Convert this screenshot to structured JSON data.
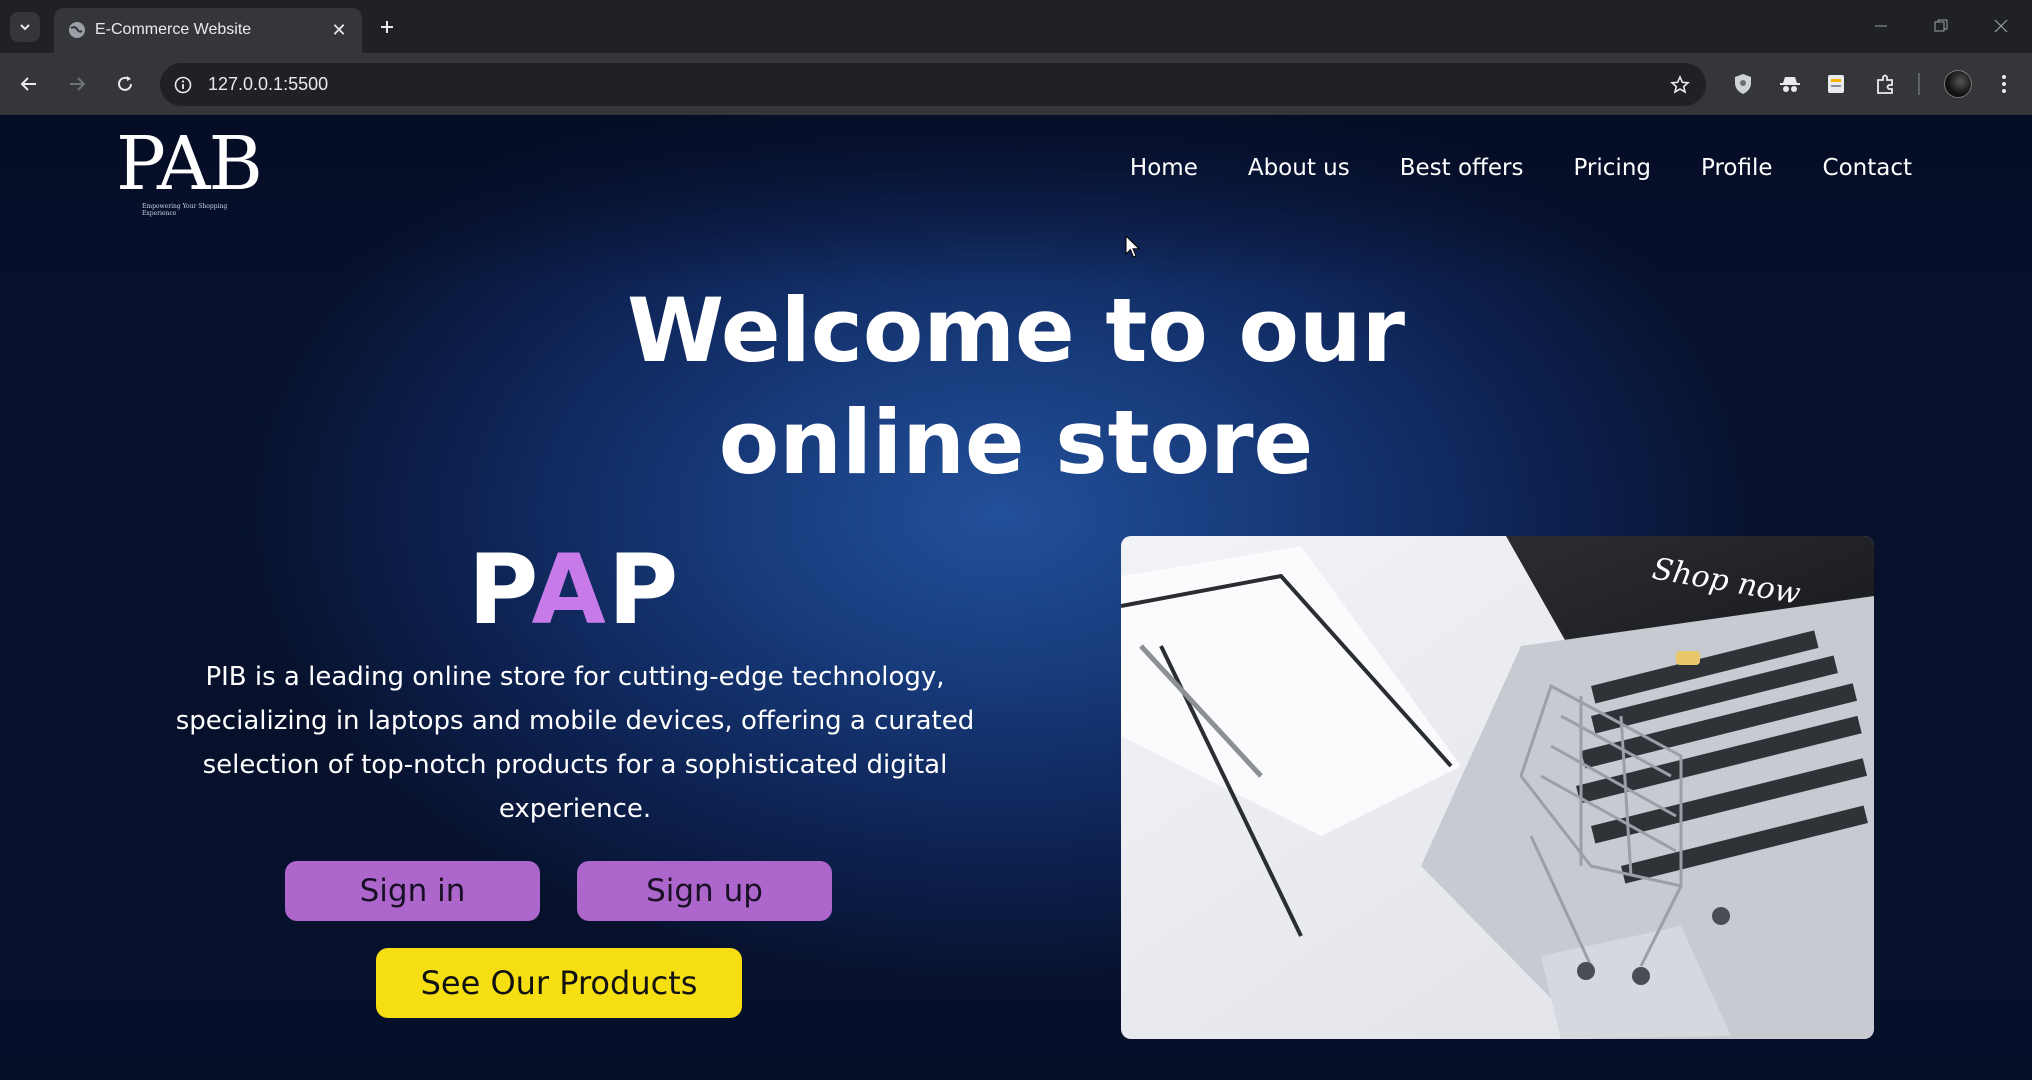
{
  "browser": {
    "tab_title": "E-Commerce Website",
    "url": "127.0.0.1:5500"
  },
  "site": {
    "logo_text": "PAB",
    "logo_tagline": "Empowering Your Shopping Experience",
    "nav": [
      "Home",
      "About us",
      "Best offers",
      "Pricing",
      "Profile",
      "Contact"
    ],
    "hero_title_line1": "Welcome to our",
    "hero_title_line2": "online store",
    "brand_part1": "P",
    "brand_part2": "A",
    "brand_part3": "P",
    "description": "PIB is a leading online store for cutting-edge technology, specializing in laptops and mobile devices, offering a curated selection of top-notch products for a sophisticated digital experience.",
    "signin_label": "Sign in",
    "signup_label": "Sign up",
    "products_label": "See Our Products",
    "image_overlay_text": "Shop now"
  },
  "colors": {
    "accent_purple": "#ad66cc",
    "brand_purple": "#c77be8",
    "accent_yellow": "#f5de12",
    "background_navy": "#0d2252"
  }
}
